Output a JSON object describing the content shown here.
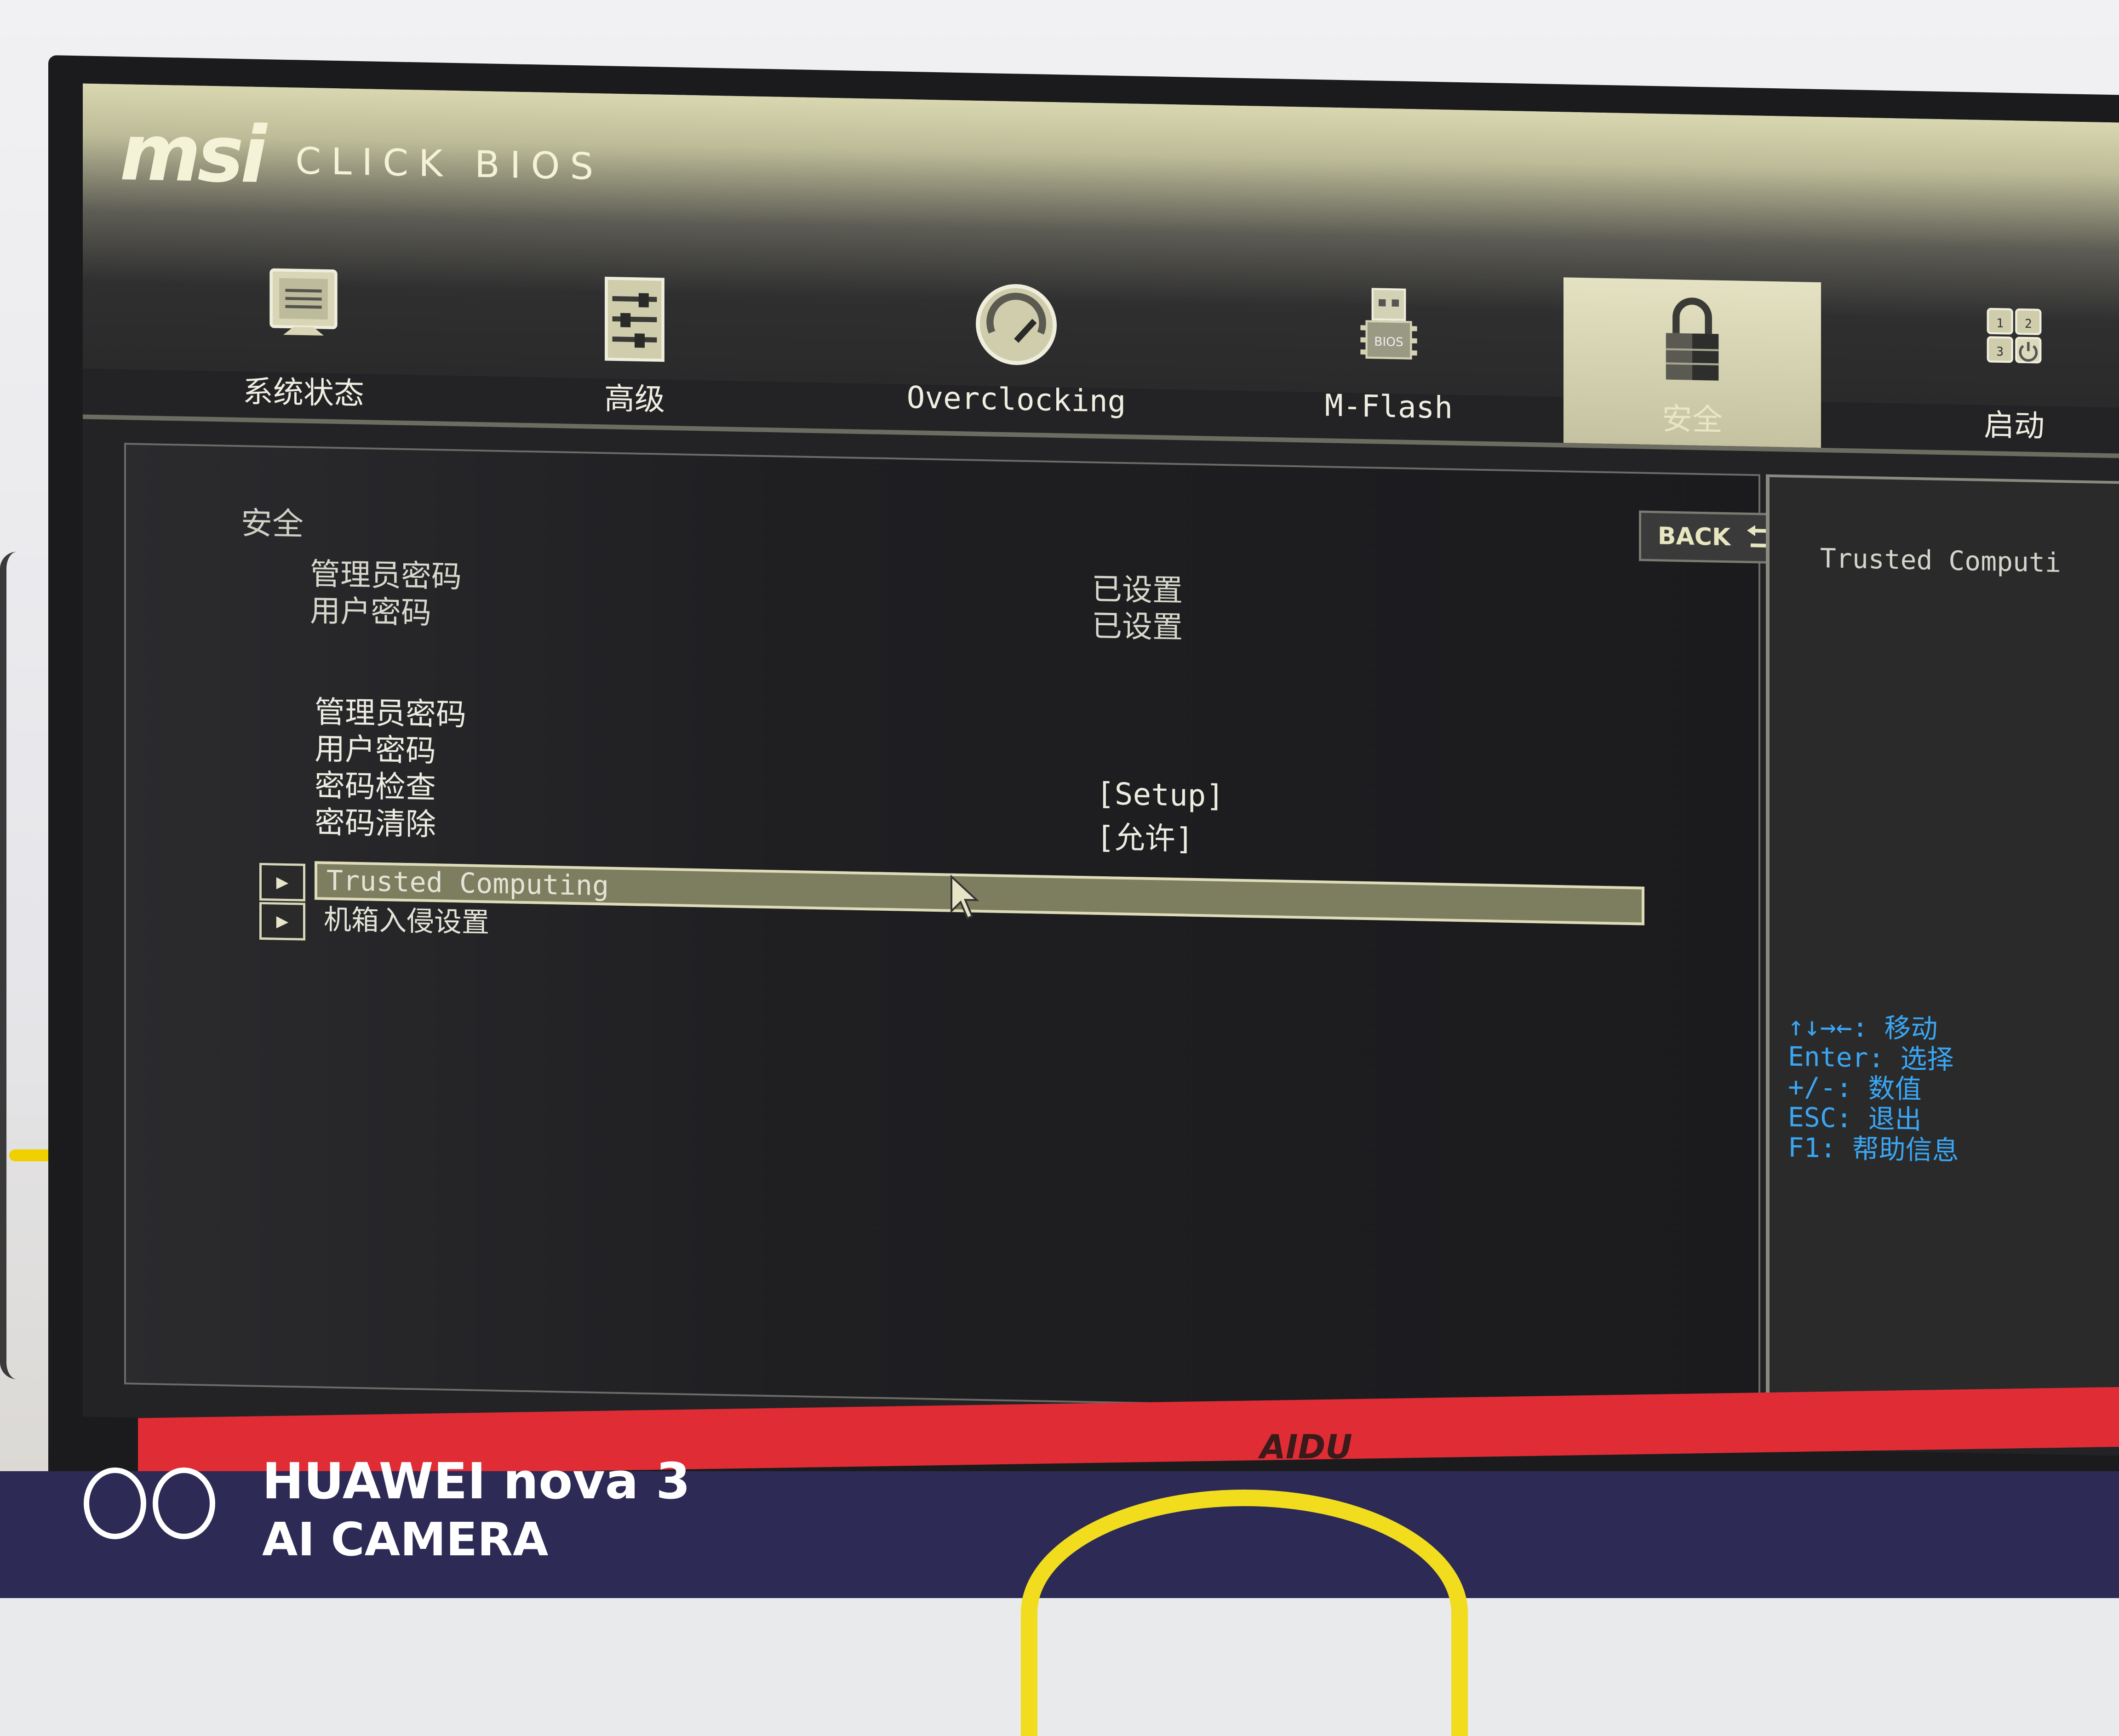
{
  "app": {
    "brand_logo": "msi",
    "product_title": "CLICK BIOS"
  },
  "tabs": [
    {
      "label": "系统状态",
      "icon": "monitor-icon",
      "active": false
    },
    {
      "label": "高级",
      "icon": "sliders-icon",
      "active": false
    },
    {
      "label": "Overclocking",
      "icon": "speedometer-icon",
      "active": false
    },
    {
      "label": "M-Flash",
      "icon": "bios-chip-usb-icon",
      "active": false
    },
    {
      "label": "安全",
      "icon": "padlock-icon",
      "active": true
    },
    {
      "label": "启动",
      "icon": "boot-order-power-icon",
      "active": false
    }
  ],
  "main": {
    "section_title": "安全",
    "back_button": "BACK",
    "status_rows": [
      {
        "label": "管理员密码",
        "value": "已设置"
      },
      {
        "label": "用户密码",
        "value": "已设置"
      }
    ],
    "setting_rows": [
      {
        "label": "管理员密码",
        "value": ""
      },
      {
        "label": "用户密码",
        "value": ""
      },
      {
        "label": "密码检查",
        "value": "[Setup]"
      },
      {
        "label": "密码清除",
        "value": "[允许]"
      }
    ],
    "submenus": [
      {
        "label": "Trusted Computing",
        "selected": true
      },
      {
        "label": "机箱入侵设置",
        "selected": false
      }
    ]
  },
  "help_panel": {
    "title": "Trusted Computi",
    "keys": [
      {
        "key": "↑↓→←:",
        "action": "移动"
      },
      {
        "key": "Enter:",
        "action": "选择"
      },
      {
        "key": "+/-:",
        "action": "数值"
      },
      {
        "key": "ESC:",
        "action": "退出"
      },
      {
        "key": "F1:",
        "action": "帮助信息"
      }
    ]
  },
  "colors": {
    "help_key_color": "#3aa6f2",
    "selected_row_bg": "#7d7d60",
    "active_tab_bg": "#d8d6b4",
    "monitor_strip": "#e02c35"
  },
  "hardware": {
    "monitor_brand": "AIDU"
  },
  "camera_watermark": {
    "line1": "HUAWEI nova 3",
    "line2": "AI CAMERA"
  }
}
